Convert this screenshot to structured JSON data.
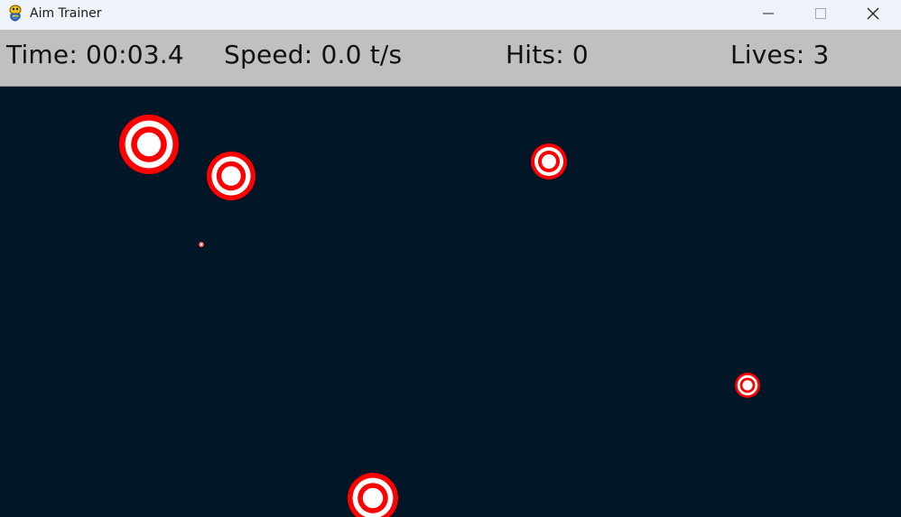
{
  "window": {
    "title": "Aim Trainer",
    "app_icon": "pygame-snake-icon",
    "controls": {
      "minimize_icon": "minimize-icon",
      "maximize_icon": "maximize-icon",
      "close_icon": "close-icon"
    }
  },
  "hud": {
    "time": "Time: 00:03.4",
    "speed": "Speed: 0.0 t/s",
    "hits": "Hits: 0",
    "lives": "Lives: 3"
  },
  "colors": {
    "titlebar_bg": "#eef3f9",
    "hud_bg": "#c0c0c0",
    "field_bg": "#011627",
    "target_red": "#ff0000",
    "target_white": "#ffffff"
  }
}
